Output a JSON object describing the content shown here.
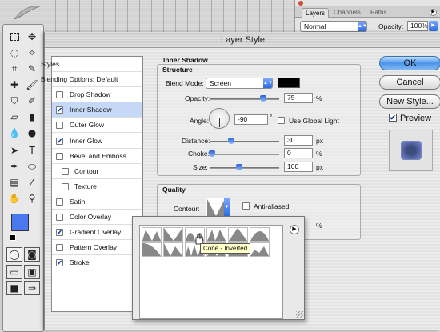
{
  "layers_panel": {
    "tabs": [
      "Layers",
      "Channels",
      "Paths"
    ],
    "blend_mode": "Normal",
    "opacity_label": "Opacity:",
    "opacity_value": "100%"
  },
  "dialog": {
    "title": "Layer Style",
    "styles_list": [
      {
        "label": "Styles",
        "checkbox": false,
        "checked": false,
        "selected": false,
        "indent": 0
      },
      {
        "label": "Blending Options: Default",
        "checkbox": false,
        "checked": false,
        "selected": false,
        "indent": 0
      },
      {
        "label": "Drop Shadow",
        "checkbox": true,
        "checked": false,
        "selected": false,
        "indent": 0
      },
      {
        "label": "Inner Shadow",
        "checkbox": true,
        "checked": true,
        "selected": true,
        "indent": 0
      },
      {
        "label": "Outer Glow",
        "checkbox": true,
        "checked": false,
        "selected": false,
        "indent": 0
      },
      {
        "label": "Inner Glow",
        "checkbox": true,
        "checked": true,
        "selected": false,
        "indent": 0
      },
      {
        "label": "Bevel and Emboss",
        "checkbox": true,
        "checked": false,
        "selected": false,
        "indent": 0
      },
      {
        "label": "Contour",
        "checkbox": true,
        "checked": false,
        "selected": false,
        "indent": 1
      },
      {
        "label": "Texture",
        "checkbox": true,
        "checked": false,
        "selected": false,
        "indent": 1
      },
      {
        "label": "Satin",
        "checkbox": true,
        "checked": false,
        "selected": false,
        "indent": 0
      },
      {
        "label": "Color Overlay",
        "checkbox": true,
        "checked": false,
        "selected": false,
        "indent": 0
      },
      {
        "label": "Gradient Overlay",
        "checkbox": true,
        "checked": true,
        "selected": false,
        "indent": 0
      },
      {
        "label": "Pattern Overlay",
        "checkbox": true,
        "checked": false,
        "selected": false,
        "indent": 0
      },
      {
        "label": "Stroke",
        "checkbox": true,
        "checked": true,
        "selected": false,
        "indent": 0
      }
    ],
    "inner_shadow": {
      "heading": "Inner Shadow",
      "structure_heading": "Structure",
      "blend_mode_label": "Blend Mode:",
      "blend_mode_value": "Screen",
      "shadow_color": "#000000",
      "opacity_label": "Opacity:",
      "opacity_value": "75",
      "opacity_unit": "%",
      "angle_label": "Angle:",
      "angle_value": "-90",
      "angle_unit": "°",
      "global_light_label": "Use Global Light",
      "global_light_checked": false,
      "distance_label": "Distance:",
      "distance_value": "30",
      "distance_unit": "px",
      "choke_label": "Choke:",
      "choke_value": "0",
      "choke_unit": "%",
      "size_label": "Size:",
      "size_value": "100",
      "size_unit": "px"
    },
    "quality": {
      "heading": "Quality",
      "contour_label": "Contour:",
      "anti_aliased_label": "Anti-aliased",
      "anti_aliased_checked": false,
      "noise_unit": "%"
    },
    "buttons": {
      "ok": "OK",
      "cancel": "Cancel",
      "new_style": "New Style...",
      "preview": "Preview",
      "preview_checked": true
    },
    "contour_popup": {
      "tooltip": "Cone - Inverted"
    }
  },
  "toolbox": {
    "foreground_color": "#4a78f0",
    "background_color": "#ffffff"
  },
  "colors": {
    "selection": "#c5d9f7",
    "accent": "#2f6de0"
  }
}
